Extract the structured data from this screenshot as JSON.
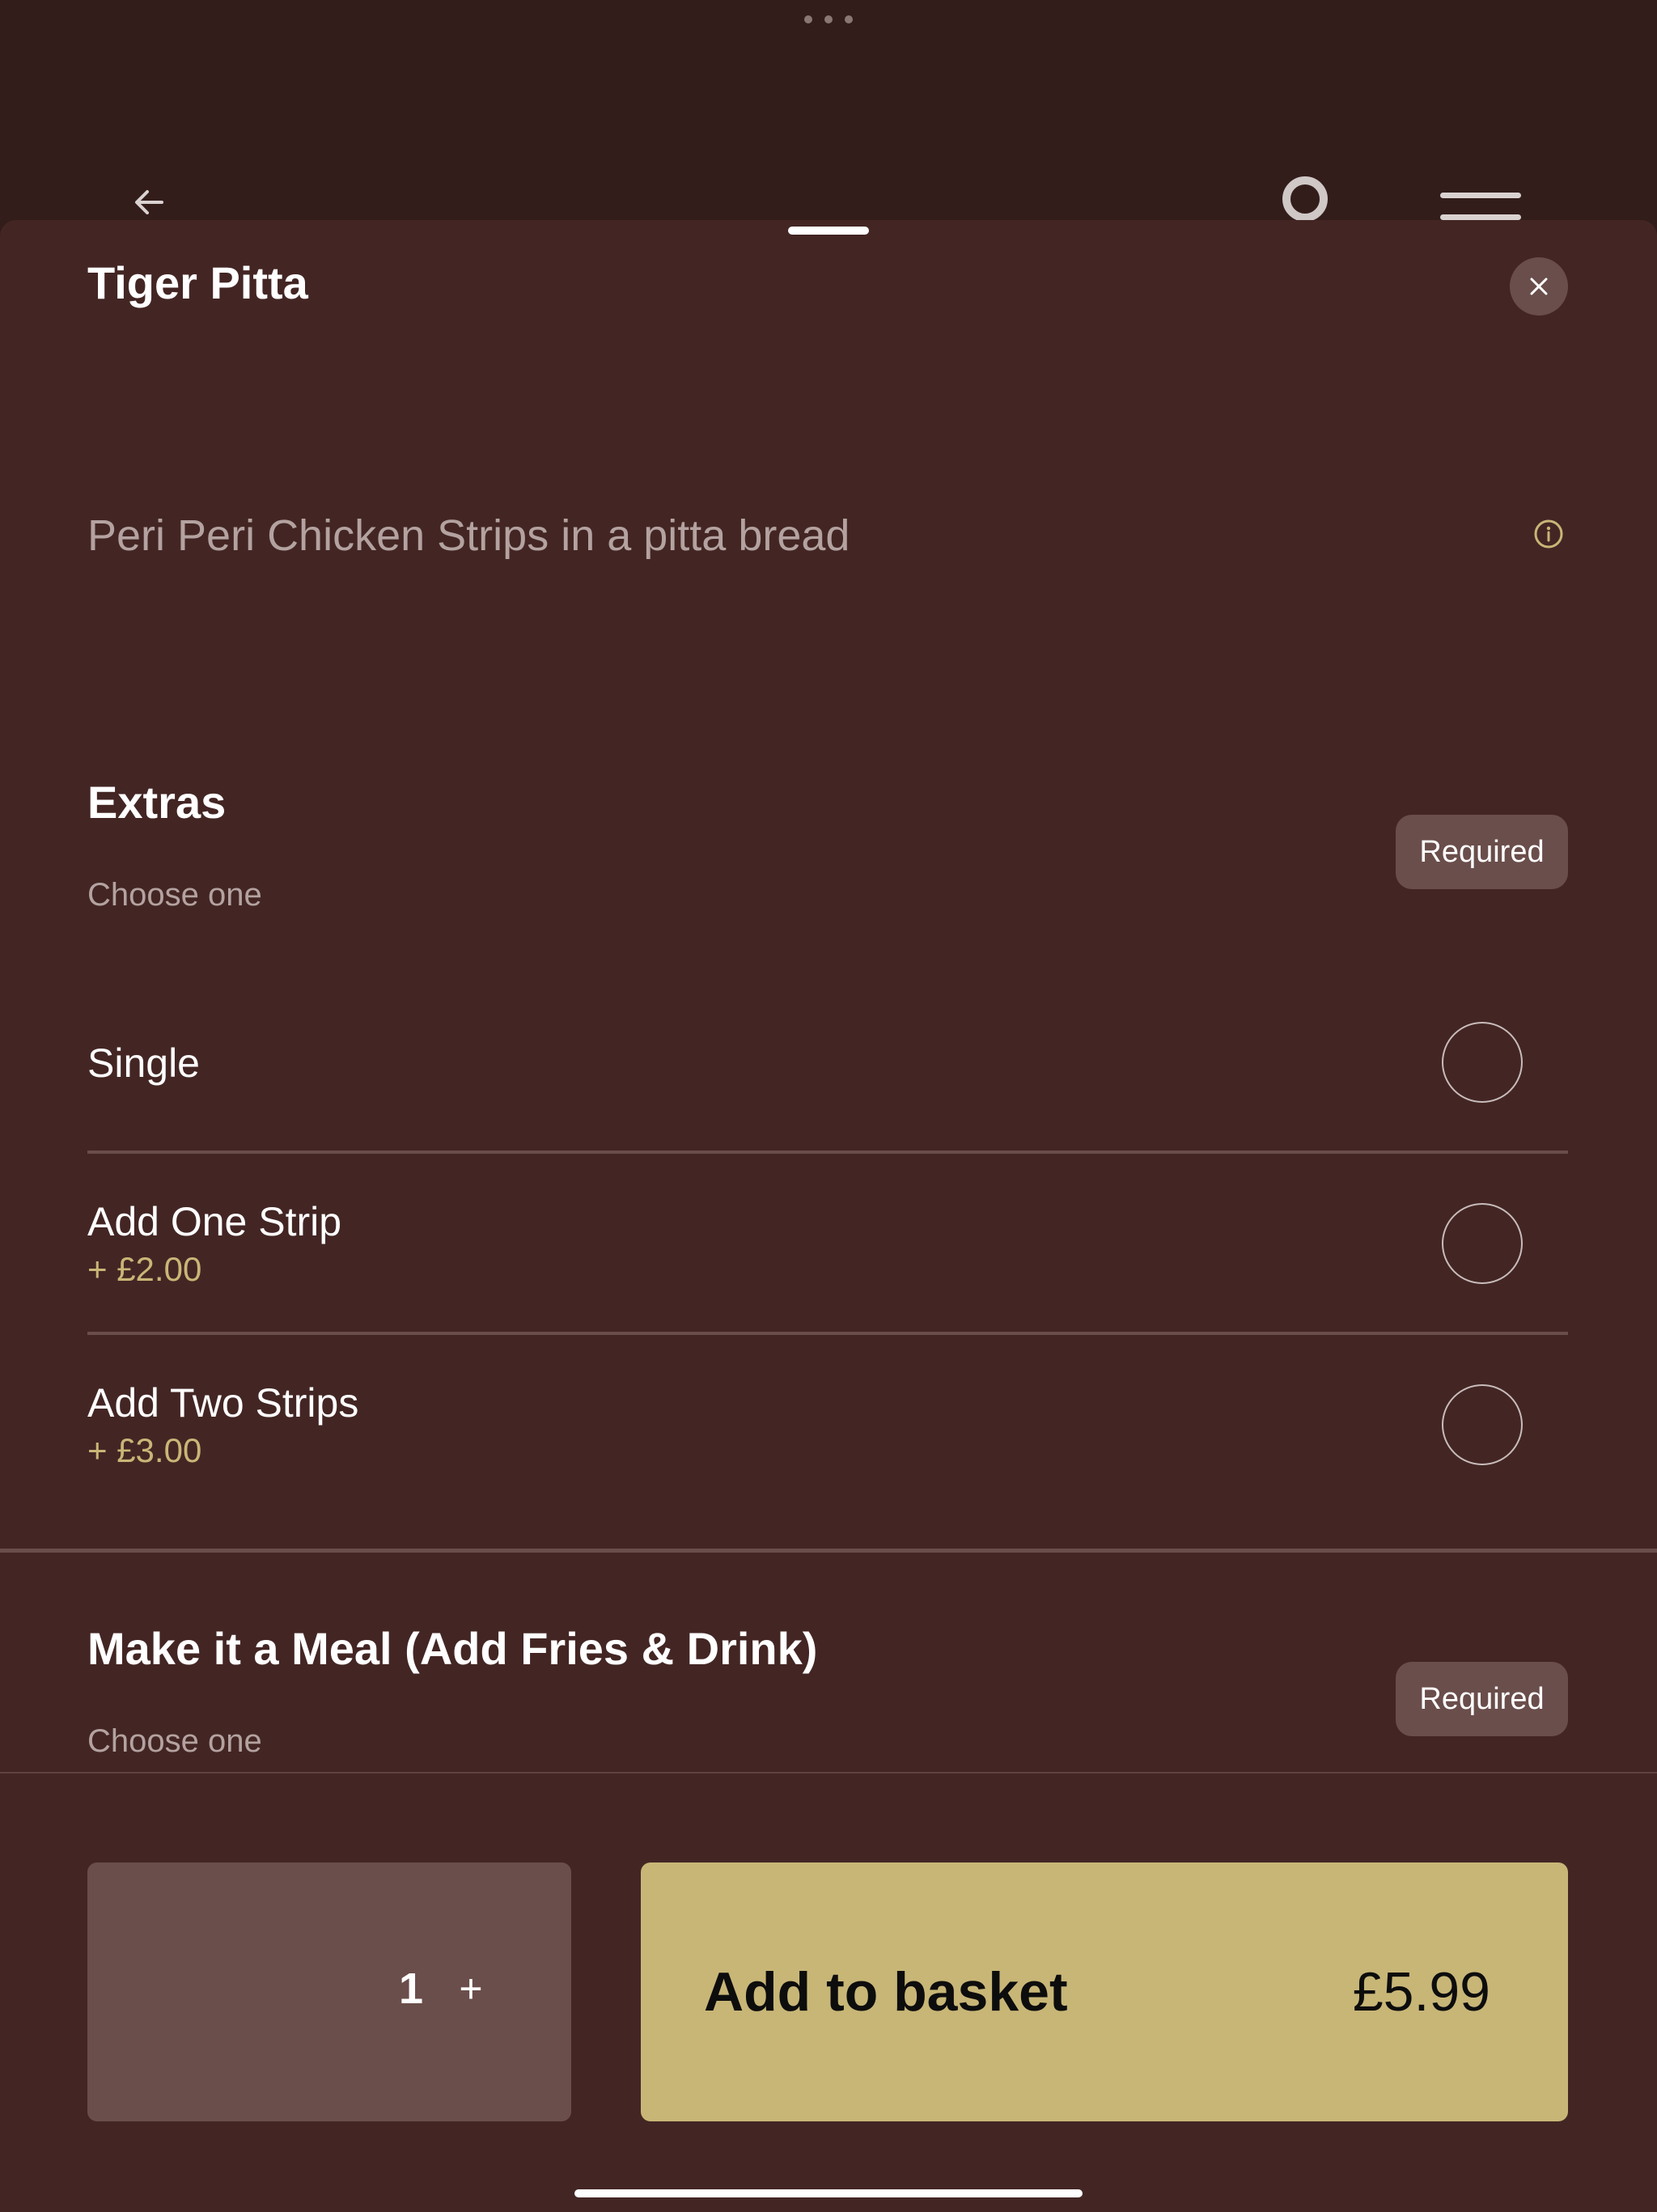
{
  "background_nav": {
    "more_icon": "ellipsis-icon",
    "back_icon": "arrow-left-icon",
    "ring_icon": "ring-icon",
    "menu_icon": "menu-icon"
  },
  "item": {
    "title": "Tiger Pitta",
    "description": "Peri Peri Chicken Strips in a pitta bread"
  },
  "sections": [
    {
      "title": "Extras",
      "subtitle": "Choose one",
      "badge": "Required",
      "options": [
        {
          "label": "Single",
          "price": ""
        },
        {
          "label": "Add One Strip",
          "price": "+ £2.00"
        },
        {
          "label": "Add Two Strips",
          "price": "+ £3.00"
        }
      ]
    },
    {
      "title": "Make it a Meal (Add Fries & Drink)",
      "subtitle": "Choose one",
      "badge": "Required",
      "options": []
    }
  ],
  "footer": {
    "quantity": "1",
    "plus": "+",
    "add_label": "Add to basket",
    "price": "£5.99"
  },
  "colors": {
    "background": "#331d1a",
    "sheet": "#432624",
    "muted_surface": "#6a4e4b",
    "accent_gold": "#c8b677",
    "muted_text": "#b3a2a0"
  }
}
